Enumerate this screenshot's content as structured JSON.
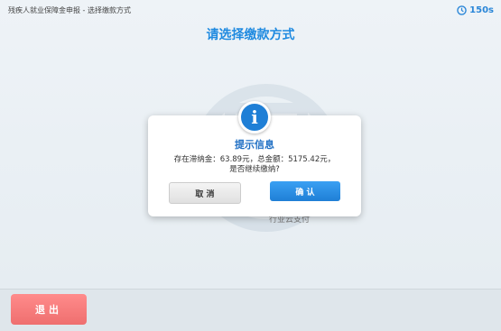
{
  "header": {
    "breadcrumb": "残疾人就业保障金申报 - 选择缴款方式",
    "timer": "150s",
    "page_title": "请选择缴款方式"
  },
  "background": {
    "caption": "行业云支付"
  },
  "dialog": {
    "title": "提示信息",
    "message_line1": "存在滞纳金：63.89元，总金额：5175.42元，",
    "message_line2": "是否继续缴纳?",
    "cancel_label": "取 消",
    "confirm_label": "确 认",
    "icon": "info-icon"
  },
  "footer": {
    "exit_label": "退出"
  },
  "colors": {
    "accent": "#1f8ae0",
    "confirm_button": "#1f7fd6",
    "exit_button": "#ef6f6f"
  }
}
